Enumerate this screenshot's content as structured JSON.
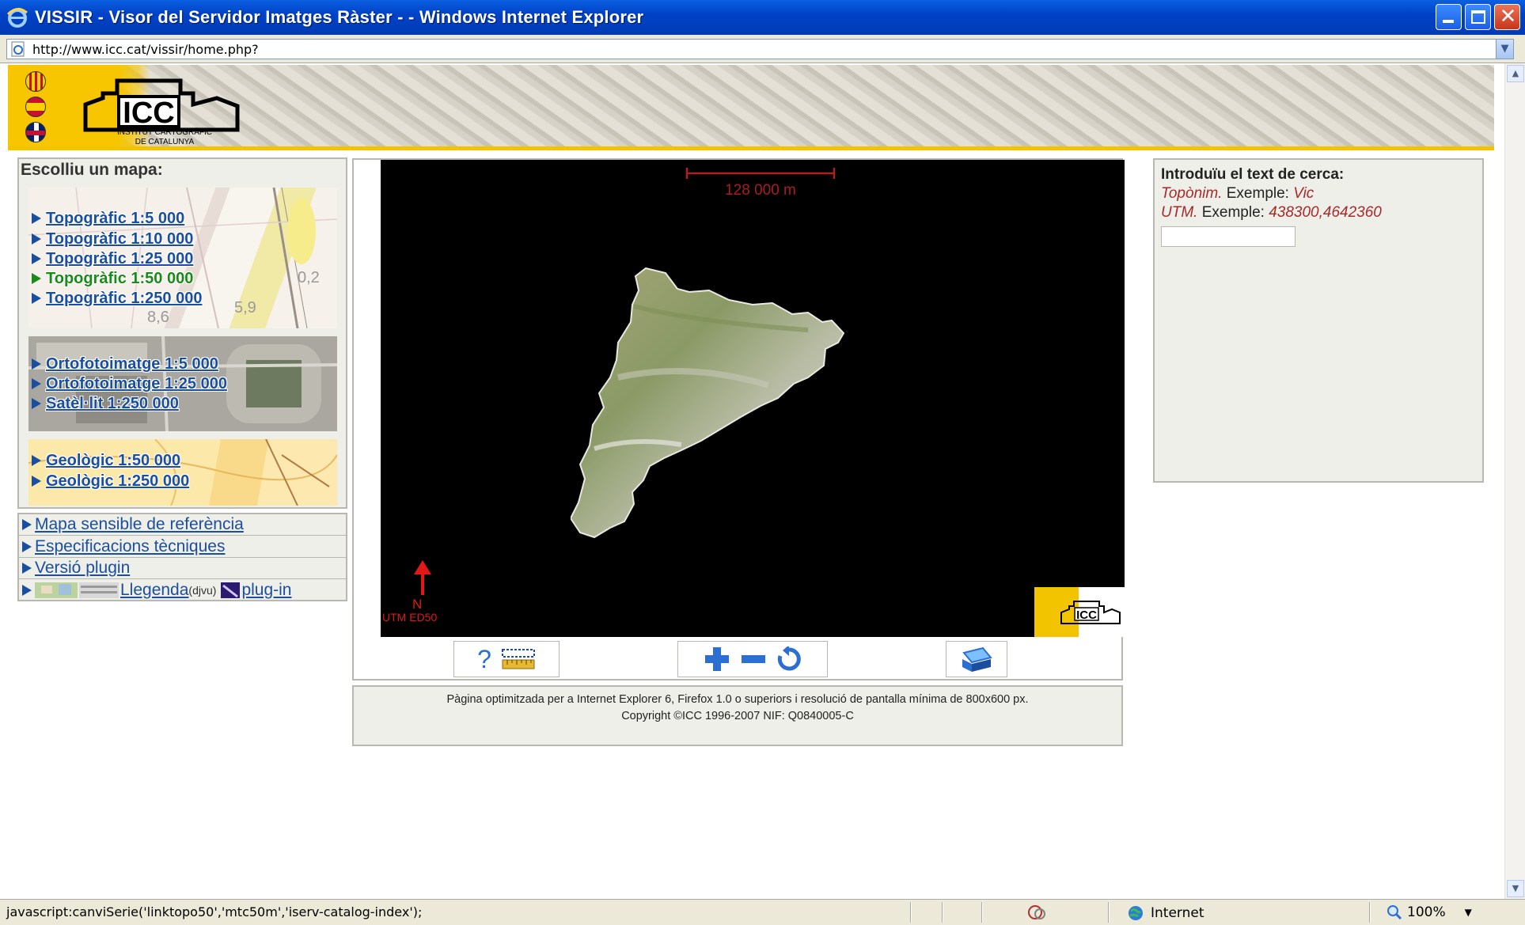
{
  "window": {
    "title": "VISSIR - Visor del Servidor Imatges Ràster - - Windows Internet Explorer",
    "url": "http://www.icc.cat/vissir/home.php?"
  },
  "header": {
    "logo_text": "ICC",
    "institute_line1": "INSTITUT CARTOGRÀFIC",
    "institute_line2": "DE CATALUNYA"
  },
  "map_selector": {
    "heading": "Escolliu un mapa:",
    "topo": [
      {
        "label": "Topogràfic 1:5 000",
        "active": false
      },
      {
        "label": "Topogràfic 1:10 000",
        "active": false
      },
      {
        "label": "Topogràfic 1:25 000",
        "active": false
      },
      {
        "label": "Topogràfic 1:50 000",
        "active": true
      },
      {
        "label": "Topogràfic 1:250 000",
        "active": false
      }
    ],
    "orto": [
      {
        "label": "Ortofotoimatge 1:5 000"
      },
      {
        "label": "Ortofotoimatge 1:25 000"
      },
      {
        "label": "Satèl·lit 1:250 000"
      }
    ],
    "geo": [
      {
        "label": "Geològic 1:50 000"
      },
      {
        "label": "Geològic 1:250 000"
      }
    ],
    "topo_bg_labels": [
      "0,2",
      "5,9",
      "8,6"
    ]
  },
  "links": {
    "reference_map": "Mapa sensible de referència",
    "tech_specs": "Especificacions tècniques",
    "plugin_version": "Versió plugin",
    "legend": "Llegenda",
    "legend_format": "(djvu)",
    "plugin": "plug-in"
  },
  "map": {
    "scale_text": "128 000 m",
    "north": "N",
    "projection": "UTM ED50"
  },
  "footer": {
    "line1": "Pàgina optimitzada per a Internet Explorer 6, Firefox 1.0 o superiors i resolució de pantalla mínima de 800x600 px.",
    "line2": "Copyright ©ICC 1996-2007 NIF: Q0840005-C"
  },
  "search": {
    "heading": "Introduïu el text de cerca:",
    "toponym_label": "Topònim.",
    "toponym_example_word": "Exemple:",
    "toponym_example": "Vic",
    "utm_label": "UTM.",
    "utm_example_word": "Exemple:",
    "utm_example": "438300,4642360",
    "input_value": ""
  },
  "statusbar": {
    "message": "javascript:canviSerie('linktopo50','mtc50m','iserv-catalog-index');",
    "zone": "Internet",
    "zoom": "100%"
  },
  "colors": {
    "link": "#1a4fa0",
    "active_link": "#1a8a1a",
    "accent_yellow": "#f2c400",
    "map_red": "#e21818"
  }
}
